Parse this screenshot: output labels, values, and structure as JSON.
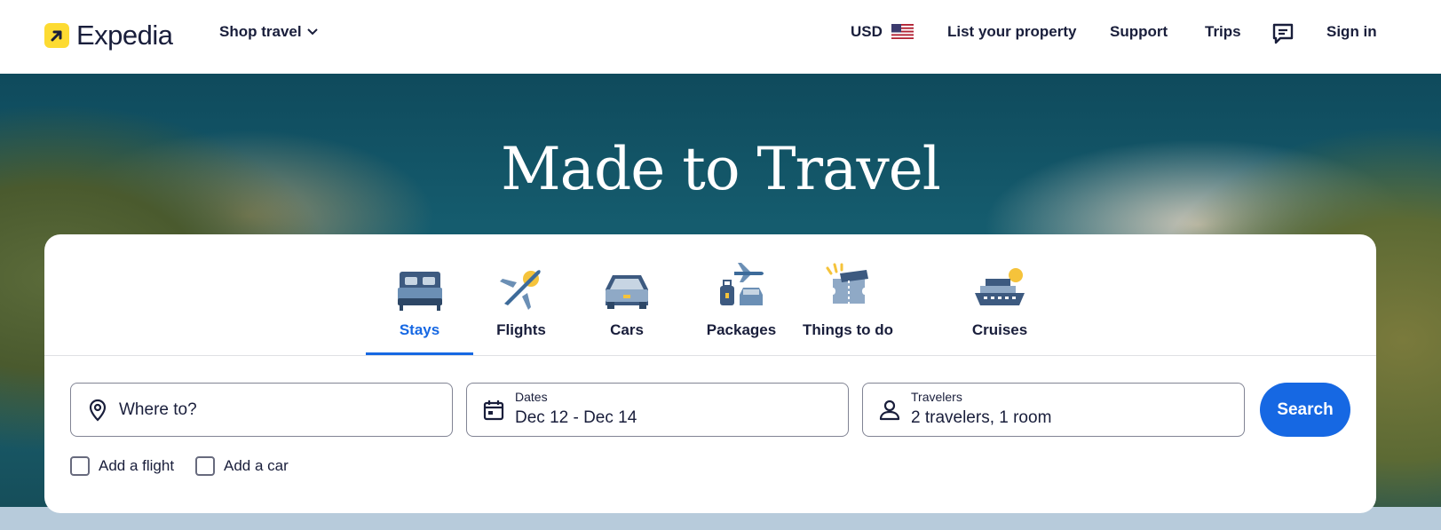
{
  "header": {
    "logo_text": "Expedia",
    "shop_travel": "Shop travel",
    "currency": "USD",
    "list_property": "List your property",
    "support": "Support",
    "trips": "Trips",
    "sign_in": "Sign in"
  },
  "hero": {
    "title": "Made to Travel"
  },
  "tabs": [
    {
      "label": "Stays",
      "active": true
    },
    {
      "label": "Flights"
    },
    {
      "label": "Cars"
    },
    {
      "label": "Packages"
    },
    {
      "label": "Things to do"
    },
    {
      "label": "Cruises"
    }
  ],
  "search": {
    "destination_placeholder": "Where to?",
    "dates_label": "Dates",
    "dates_value": "Dec 12 - Dec 14",
    "travelers_label": "Travelers",
    "travelers_value": "2 travelers, 1 room",
    "search_button": "Search",
    "add_flight": "Add a flight",
    "add_car": "Add a car"
  },
  "colors": {
    "brand_yellow": "#fddb32",
    "accent_blue": "#1668e3",
    "text_dark": "#191e3b"
  }
}
